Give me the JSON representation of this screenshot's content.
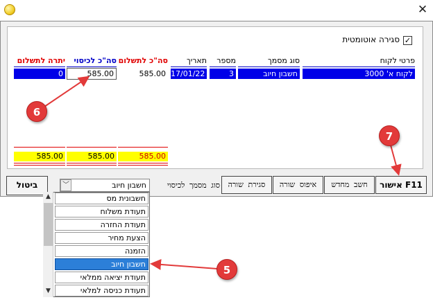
{
  "window": {
    "close_glyph": "✕"
  },
  "auto_close": {
    "label": "סגירה אוטומטית",
    "checked": true,
    "check_glyph": "✓"
  },
  "columns": [
    {
      "key": "customer",
      "label": "פרטי לקוח",
      "style": "plain"
    },
    {
      "key": "doc_type",
      "label": "סוג מסמך",
      "style": "plain"
    },
    {
      "key": "number",
      "label": "מספר",
      "style": "plain"
    },
    {
      "key": "date",
      "label": "תאריך",
      "style": "plain"
    },
    {
      "key": "total_to_pay",
      "label": "סה\"כ לתשלום",
      "style": "red"
    },
    {
      "key": "total_cover",
      "label": "סה\"כ לכיסוי",
      "style": "blue"
    },
    {
      "key": "remaining",
      "label": "יתרה לתשלום",
      "style": "red"
    }
  ],
  "row": {
    "customer": "לקוח א'  3000",
    "doc_type": "חשבון חיוב",
    "number": "3",
    "date": "17/01/22",
    "total_to_pay": "585.00",
    "total_cover": "585.00",
    "remaining": "0"
  },
  "totals": {
    "total_to_pay": "585.00",
    "total_cover": "585.00",
    "remaining": "585.00"
  },
  "buttons": {
    "confirm": "אישור F11",
    "recalc": "חשב מחדש",
    "reset_line": "איפוס שורה",
    "close_line": "סגירת שורה",
    "cancel": "ביטול"
  },
  "doc_type_label": "סוג מסמך לכיסוי",
  "doc_type_select": {
    "value": "חשבון חיוב"
  },
  "dropdown_options": [
    "חשבונית מס",
    "תעודת משלוח",
    "תעודת החזרה",
    "הצעת מחיר",
    "הזמנה",
    "חשבון חיוב",
    "תעודת יציאה ממלאי",
    "תעודת כניסה למלאי"
  ],
  "dropdown_selected_index": 5,
  "callouts": {
    "c5": "5",
    "c6": "6",
    "c7": "7"
  },
  "colors": {
    "accent_blue": "#0000e8",
    "total_yellow": "#ffff00",
    "callout_red": "#e23a3a",
    "selected_blue": "#2c7fd8"
  }
}
